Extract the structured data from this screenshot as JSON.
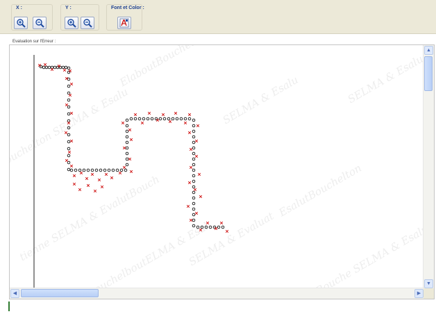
{
  "toolbar": {
    "x_group_label": "X :",
    "y_group_label": "Y :",
    "font_group_label": "Font et Color :",
    "buttons": {
      "x_zoom_in": "zoom-in-icon",
      "x_zoom_out": "zoom-out-icon",
      "y_zoom_in": "zoom-in-icon",
      "y_zoom_out": "zoom-out-icon",
      "font_color": "font-color-icon"
    }
  },
  "panel": {
    "title": "Evaluation sur l'Erreur :"
  },
  "watermark": {
    "texts": [
      "Bouchelton SELMA & Esalu",
      "ElaboutBouchelton",
      "SELMA & Esalu",
      "EsalutBouchelton",
      "SELMA & Esalu",
      "BouchelboutELMA & Esal",
      "tienne SELMA & EvalutBouch",
      "SELMA & Evaluat",
      "Bouche SELMA & Esalu"
    ],
    "color": "#969696"
  },
  "chart_data": {
    "type": "scatter",
    "title": "",
    "xlabel": "",
    "ylabel": "",
    "xlim": [
      0,
      560
    ],
    "ylim": [
      0,
      320
    ],
    "grid": false,
    "series": [
      {
        "marker": "o",
        "color": "#111111",
        "points": [
          [
            10,
            303
          ],
          [
            14,
            302
          ],
          [
            18,
            302
          ],
          [
            22,
            302
          ],
          [
            26,
            302
          ],
          [
            30,
            302
          ],
          [
            34,
            302
          ],
          [
            38,
            302
          ],
          [
            42,
            302
          ],
          [
            46,
            302
          ],
          [
            50,
            301
          ],
          [
            50,
            295
          ],
          [
            50,
            285
          ],
          [
            50,
            275
          ],
          [
            50,
            265
          ],
          [
            50,
            255
          ],
          [
            50,
            245
          ],
          [
            50,
            235
          ],
          [
            50,
            225
          ],
          [
            50,
            215
          ],
          [
            50,
            205
          ],
          [
            50,
            195
          ],
          [
            50,
            185
          ],
          [
            50,
            175
          ],
          [
            50,
            165
          ],
          [
            50,
            155
          ],
          [
            54,
            154
          ],
          [
            60,
            154
          ],
          [
            66,
            154
          ],
          [
            72,
            154
          ],
          [
            78,
            154
          ],
          [
            84,
            154
          ],
          [
            90,
            154
          ],
          [
            96,
            154
          ],
          [
            102,
            154
          ],
          [
            108,
            154
          ],
          [
            114,
            154
          ],
          [
            120,
            154
          ],
          [
            126,
            154
          ],
          [
            132,
            154
          ],
          [
            134,
            162
          ],
          [
            134,
            170
          ],
          [
            134,
            178
          ],
          [
            134,
            186
          ],
          [
            134,
            194
          ],
          [
            134,
            202
          ],
          [
            134,
            210
          ],
          [
            134,
            218
          ],
          [
            134,
            226
          ],
          [
            140,
            228
          ],
          [
            146,
            228
          ],
          [
            152,
            228
          ],
          [
            158,
            228
          ],
          [
            164,
            228
          ],
          [
            170,
            228
          ],
          [
            176,
            228
          ],
          [
            182,
            228
          ],
          [
            188,
            228
          ],
          [
            194,
            228
          ],
          [
            200,
            228
          ],
          [
            206,
            228
          ],
          [
            212,
            228
          ],
          [
            218,
            228
          ],
          [
            224,
            228
          ],
          [
            230,
            226
          ],
          [
            230,
            218
          ],
          [
            230,
            210
          ],
          [
            230,
            202
          ],
          [
            230,
            194
          ],
          [
            230,
            186
          ],
          [
            230,
            178
          ],
          [
            230,
            170
          ],
          [
            230,
            162
          ],
          [
            230,
            154
          ],
          [
            230,
            146
          ],
          [
            230,
            138
          ],
          [
            230,
            130
          ],
          [
            230,
            122
          ],
          [
            230,
            114
          ],
          [
            230,
            106
          ],
          [
            230,
            98
          ],
          [
            230,
            90
          ],
          [
            230,
            82
          ],
          [
            230,
            74
          ],
          [
            236,
            72
          ],
          [
            242,
            72
          ],
          [
            248,
            72
          ],
          [
            254,
            72
          ],
          [
            260,
            72
          ],
          [
            266,
            72
          ],
          [
            272,
            72
          ]
        ]
      },
      {
        "marker": "x",
        "color": "#d01818",
        "points": [
          [
            8,
            305
          ],
          [
            16,
            306
          ],
          [
            26,
            299
          ],
          [
            36,
            304
          ],
          [
            44,
            298
          ],
          [
            52,
            297
          ],
          [
            47,
            286
          ],
          [
            54,
            278
          ],
          [
            52,
            262
          ],
          [
            47,
            248
          ],
          [
            54,
            236
          ],
          [
            50,
            222
          ],
          [
            46,
            208
          ],
          [
            54,
            196
          ],
          [
            51,
            180
          ],
          [
            47,
            168
          ],
          [
            54,
            160
          ],
          [
            58,
            146
          ],
          [
            68,
            150
          ],
          [
            76,
            142
          ],
          [
            84,
            148
          ],
          [
            94,
            140
          ],
          [
            104,
            148
          ],
          [
            112,
            143
          ],
          [
            124,
            150
          ],
          [
            130,
            158
          ],
          [
            140,
            152
          ],
          [
            138,
            170
          ],
          [
            130,
            186
          ],
          [
            140,
            198
          ],
          [
            138,
            212
          ],
          [
            128,
            222
          ],
          [
            146,
            234
          ],
          [
            156,
            222
          ],
          [
            166,
            236
          ],
          [
            178,
            226
          ],
          [
            186,
            234
          ],
          [
            196,
            224
          ],
          [
            204,
            236
          ],
          [
            218,
            222
          ],
          [
            224,
            234
          ],
          [
            236,
            218
          ],
          [
            224,
            208
          ],
          [
            234,
            196
          ],
          [
            226,
            184
          ],
          [
            234,
            174
          ],
          [
            226,
            158
          ],
          [
            238,
            148
          ],
          [
            224,
            136
          ],
          [
            232,
            126
          ],
          [
            240,
            116
          ],
          [
            222,
            102
          ],
          [
            234,
            92
          ],
          [
            226,
            82
          ],
          [
            240,
            68
          ],
          [
            250,
            78
          ],
          [
            262,
            70
          ],
          [
            270,
            78
          ],
          [
            278,
            66
          ],
          [
            58,
            134
          ],
          [
            66,
            126
          ],
          [
            78,
            132
          ],
          [
            88,
            124
          ],
          [
            98,
            130
          ]
        ]
      }
    ]
  }
}
